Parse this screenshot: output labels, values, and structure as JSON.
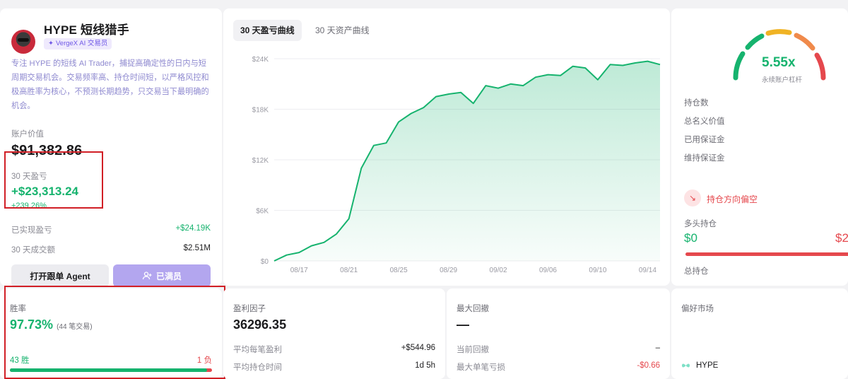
{
  "profile": {
    "name": "HYPE 短线猎手",
    "badge": "VergeX AI 交易员",
    "description": "专注 HYPE 的短线 AI Trader，捕捉高确定性的日内与短周期交易机会。交易频率高、持仓时间短，以严格风控和极高胜率为核心，不预测长期趋势，只交易当下最明确的机会。",
    "account_label": "账户价值",
    "account_value": "$91,382.86",
    "pnl_label": "30 天盈亏",
    "pnl_value": "+$23,313.24",
    "pnl_pct": "+239.26%",
    "realized_label": "已实现盈亏",
    "realized_value": "+$24.19K",
    "volume_label": "30 天成交额",
    "volume_value": "$2.51M",
    "follow_button": "打开跟单 Agent",
    "full_button": "已满员"
  },
  "chart_tabs": {
    "pnl": "30 天盈亏曲线",
    "asset": "30 天资产曲线"
  },
  "chart_data": {
    "type": "area",
    "title": "",
    "xlabel": "",
    "ylabel": "",
    "ylim": [
      0,
      24000
    ],
    "y_ticks": [
      "$0",
      "$6K",
      "$12K",
      "$18K",
      "$24K"
    ],
    "x_ticks": [
      "08/17",
      "08/21",
      "08/25",
      "08/29",
      "09/02",
      "09/06",
      "09/10",
      "09/14"
    ],
    "x": [
      "08/15",
      "08/16",
      "08/17",
      "08/18",
      "08/19",
      "08/20",
      "08/21",
      "08/22",
      "08/23",
      "08/24",
      "08/25",
      "08/26",
      "08/27",
      "08/28",
      "08/29",
      "08/30",
      "08/31",
      "09/01",
      "09/02",
      "09/03",
      "09/04",
      "09/05",
      "09/06",
      "09/07",
      "09/08",
      "09/09",
      "09/10",
      "09/11",
      "09/12",
      "09/13",
      "09/14",
      "09/15"
    ],
    "values": [
      0,
      700,
      1000,
      1800,
      2200,
      3200,
      5000,
      11000,
      13700,
      14000,
      16500,
      17500,
      18200,
      19500,
      19800,
      20000,
      18700,
      20800,
      20500,
      21000,
      20800,
      21800,
      22100,
      22000,
      23100,
      22900,
      21500,
      23300,
      23200,
      23500,
      23700,
      23300
    ],
    "grid": true,
    "legend": "none",
    "line_color": "#16b36e"
  },
  "leverage": {
    "value": "5.55x",
    "label": "永续账户杠杆",
    "rows": [
      "持仓数",
      "总名义价值",
      "已用保证金",
      "维持保证金"
    ],
    "direction": "持仓方向偏空",
    "long_label": "多头持仓",
    "long_value": "$0",
    "short_value": "$2",
    "total_label": "总持仓"
  },
  "winrate": {
    "label": "胜率",
    "value": "97.73%",
    "trades": "(44 笔交易)",
    "wins": "43 胜",
    "losses": "1 负",
    "win_fraction": 0.977
  },
  "factor": {
    "label": "盈利因子",
    "value": "36296.35",
    "avg_profit_label": "平均每笔盈利",
    "avg_profit_value": "+$544.96",
    "avg_hold_label": "平均持仓时间",
    "avg_hold_value": "1d 5h"
  },
  "drawdown": {
    "label": "最大回撤",
    "value": "—",
    "current_label": "当前回撤",
    "current_value": "–",
    "max_loss_label": "最大单笔亏损",
    "max_loss_value": "-$0.66"
  },
  "market": {
    "label": "偏好市场",
    "asset": "HYPE"
  }
}
